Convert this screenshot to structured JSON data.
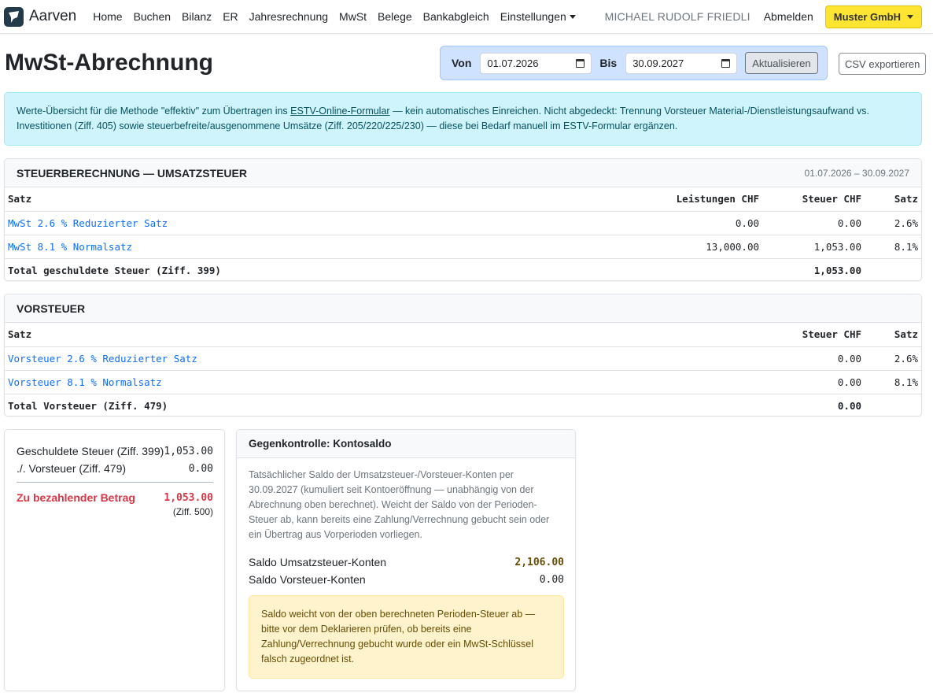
{
  "nav": {
    "brand": "Aarven",
    "items": [
      "Home",
      "Buchen",
      "Bilanz",
      "ER",
      "Jahresrechnung",
      "MwSt",
      "Belege",
      "Bankabgleich"
    ],
    "settings": "Einstellungen",
    "user": "MICHAEL RUDOLF FRIEDLI",
    "logout": "Abmelden",
    "company": "Muster GmbH"
  },
  "header": {
    "title": "MwSt-Abrechnung",
    "from_label": "Von",
    "from_value": "01.07.2026",
    "to_label": "Bis",
    "to_value": "30.09.2027",
    "refresh": "Aktualisieren",
    "csv": "CSV exportieren"
  },
  "info": {
    "before": "Werte-Übersicht für die Methode \"effektiv\" zum Übertragen ins ",
    "link": "ESTV-Online-Formular",
    "after": " — kein automatisches Einreichen. Nicht abgedeckt: Trennung Vorsteuer Material-/Dienstleistungsaufwand vs. Investitionen (Ziff. 405) sowie steuerbefreite/ausgenommene Umsätze (Ziff. 205/220/225/230) — diese bei Bedarf manuell im ESTV-Formular ergänzen."
  },
  "umsatz": {
    "title": "STEUERBERECHNUNG — UMSATZSTEUER",
    "period": "01.07.2026 – 30.09.2027",
    "headers": [
      "Satz",
      "Leistungen CHF",
      "Steuer CHF",
      "Satz"
    ],
    "rows": [
      {
        "name": "MwSt 2.6 % Reduzierter Satz",
        "leistungen": "0.00",
        "steuer": "0.00",
        "satz": "2.6%"
      },
      {
        "name": "MwSt 8.1 % Normalsatz",
        "leistungen": "13,000.00",
        "steuer": "1,053.00",
        "satz": "8.1%"
      }
    ],
    "total_label": "Total geschuldete Steuer (Ziff. 399)",
    "total_value": "1,053.00"
  },
  "vorsteuer": {
    "title": "VORSTEUER",
    "headers": [
      "Satz",
      "Steuer CHF",
      "Satz"
    ],
    "rows": [
      {
        "name": "Vorsteuer 2.6 % Reduzierter Satz",
        "steuer": "0.00",
        "satz": "2.6%"
      },
      {
        "name": "Vorsteuer 8.1 % Normalsatz",
        "steuer": "0.00",
        "satz": "8.1%"
      }
    ],
    "total_label": "Total Vorsteuer (Ziff. 479)",
    "total_value": "0.00"
  },
  "summary": {
    "owed_label": "Geschuldete Steuer (Ziff. 399)",
    "owed_value": "1,053.00",
    "input_label": "./. Vorsteuer (Ziff. 479)",
    "input_value": "0.00",
    "due_label": "Zu bezahlender Betrag",
    "due_value": "1,053.00",
    "due_note": "(Ziff. 500)"
  },
  "control": {
    "title": "Gegenkontrolle: Kontosaldo",
    "text": "Tatsächlicher Saldo der Umsatzsteuer-/Vorsteuer-Konten per 30.09.2027 (kumuliert seit Kontoeröffnung — unabhängig von der Abrechnung oben berechnet). Weicht der Saldo von der Perioden-Steuer ab, kann bereits eine Zahlung/Verrechnung gebucht sein oder ein Übertrag aus Vorperioden vorliegen.",
    "umsatz_label": "Saldo Umsatzsteuer-Konten",
    "umsatz_value": "2,106.00",
    "vor_label": "Saldo Vorsteuer-Konten",
    "vor_value": "0.00",
    "warning": "Saldo weicht von der oben berechneten Perioden-Steuer ab — bitte vor dem Deklarieren prüfen, ob bereits eine Zahlung/Verrechnung gebucht wurde oder ein MwSt-Schlüssel falsch zugeordnet ist."
  },
  "colors": {
    "accent": "#0d6efd",
    "company_button": "#ffe533",
    "due": "#dc3545",
    "info_bg": "#cff4fc",
    "warning_bg": "#fff3cd"
  }
}
